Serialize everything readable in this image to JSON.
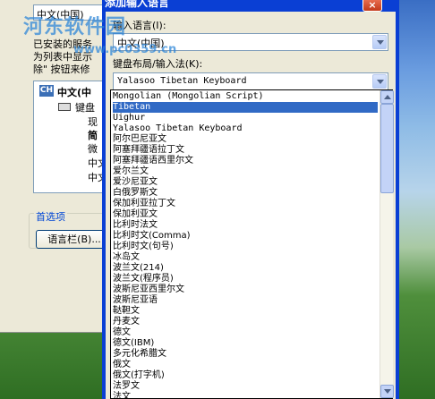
{
  "watermark": {
    "logo_text": "河东软件园",
    "url": "www.pc0359.cn"
  },
  "background_dialog": {
    "language_select": "中文(中国)",
    "text_lines": [
      "已安装的服务",
      "为列表中显示",
      "除\" 按钮来修"
    ],
    "tree": {
      "root": "中文(中",
      "badge": "CH",
      "items": [
        "键盘",
        "现",
        "简",
        "微",
        "中文",
        "中文"
      ]
    },
    "preferences_label": "首选项",
    "language_bar_button": "语言栏(B)..."
  },
  "dialog": {
    "title": "添加输入语言",
    "close": "×",
    "input_language_label": "输入语言(I):",
    "input_language_value": "中文(中国)",
    "keyboard_label": "键盘布局/输入法(K):",
    "keyboard_value": "Yalasoo Tibetan Keyboard"
  },
  "keyboard_options": [
    {
      "label": "Mongolian (Mongolian Script)",
      "mono": true
    },
    {
      "label": "Tibetan",
      "mono": true,
      "selected": true
    },
    {
      "label": "Uighur",
      "mono": true
    },
    {
      "label": "Yalasoo Tibetan Keyboard",
      "mono": true
    },
    {
      "label": "阿尔巴尼亚文"
    },
    {
      "label": "阿塞拜疆语拉丁文"
    },
    {
      "label": "阿塞拜疆语西里尔文"
    },
    {
      "label": "爱尔兰文"
    },
    {
      "label": "爱沙尼亚文"
    },
    {
      "label": "白俄罗斯文"
    },
    {
      "label": "保加利亚拉丁文"
    },
    {
      "label": "保加利亚文"
    },
    {
      "label": "比利时法文"
    },
    {
      "label": "比利时文(Comma)"
    },
    {
      "label": "比利时文(句号)"
    },
    {
      "label": "冰岛文"
    },
    {
      "label": "波兰文(214)"
    },
    {
      "label": "波兰文(程序员)"
    },
    {
      "label": "波斯尼亚西里尔文"
    },
    {
      "label": "波斯尼亚语"
    },
    {
      "label": "鞑靼文"
    },
    {
      "label": "丹麦文"
    },
    {
      "label": "德文"
    },
    {
      "label": "德文(IBM)"
    },
    {
      "label": "多元化希腊文"
    },
    {
      "label": "俄文"
    },
    {
      "label": "俄文(打字机)"
    },
    {
      "label": "法罗文"
    },
    {
      "label": "法文"
    }
  ]
}
